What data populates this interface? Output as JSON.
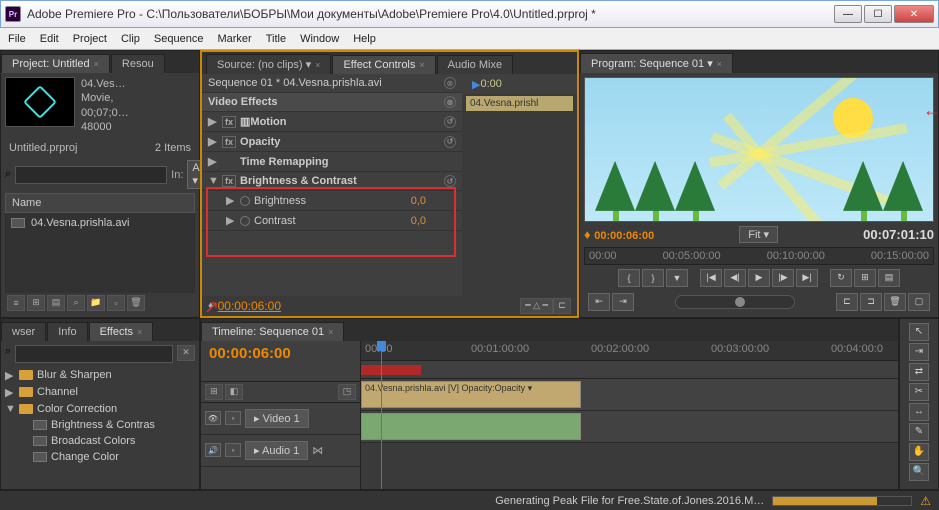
{
  "window": {
    "app_icon_text": "Pr",
    "title": "Adobe Premiere Pro - C:\\Пользователи\\БОБРЫ\\Мои документы\\Adobe\\Premiere Pro\\4.0\\Untitled.prproj *"
  },
  "menu": [
    "File",
    "Edit",
    "Project",
    "Clip",
    "Sequence",
    "Marker",
    "Title",
    "Window",
    "Help"
  ],
  "project": {
    "tab1": "Project: Untitled",
    "tab2": "Resou",
    "preview": {
      "name": "04.Ves…",
      "type": "Movie,",
      "dur": "00;07;0…",
      "rate": "48000 "
    },
    "name": "Untitled.prproj",
    "items_count": "2 Items",
    "search_placeholder": "",
    "search_icon": "⌕",
    "in_label": "In:",
    "in_value": "All",
    "header": "Name",
    "item1": "04.Vesna.prishla.avi"
  },
  "source_tabs": {
    "t1": "Source: (no clips)",
    "t2": "Effect Controls",
    "t3": "Audio Mixe"
  },
  "effect_controls": {
    "title": "Sequence 01 * 04.Vesna.prishla.avi",
    "section": "Video Effects",
    "r_motion": "Motion",
    "r_opacity": "Opacity",
    "r_time": "Time Remapping",
    "r_bc": "Brightness & Contrast",
    "r_bright": "Brightness",
    "r_bright_val": "0,0",
    "r_contrast": "Contrast",
    "r_contrast_val": "0,0",
    "tc": "00:00:06:00",
    "mini_tc": "0:00",
    "clip_label": "04.Vesna.prishl"
  },
  "program": {
    "tab": "Program: Sequence 01",
    "tc": "00:00:06:00",
    "fit": "Fit",
    "dur": "00:07:01:10",
    "ruler": [
      "00:00",
      "00:05:00:00",
      "00:10:00:00",
      "00:15:00:00"
    ]
  },
  "effects_browser": {
    "tab1": "wser",
    "tab2": "Info",
    "tab3": "Effects",
    "items": [
      {
        "name": "Blur & Sharpen",
        "type": "folder",
        "indent": 0,
        "tri": "▶"
      },
      {
        "name": "Channel",
        "type": "folder",
        "indent": 0,
        "tri": "▶"
      },
      {
        "name": "Color Correction",
        "type": "folder",
        "indent": 0,
        "tri": "▼"
      },
      {
        "name": "Brightness & Contras",
        "type": "fx",
        "indent": 1,
        "tri": ""
      },
      {
        "name": "Broadcast Colors",
        "type": "fx",
        "indent": 1,
        "tri": ""
      },
      {
        "name": "Change Color",
        "type": "fx",
        "indent": 1,
        "tri": ""
      }
    ]
  },
  "timeline": {
    "tab": "Timeline: Sequence 01",
    "tc": "00:00:06:00",
    "ruler": [
      "00:00",
      "00:01:00:00",
      "00:02:00:00",
      "00:03:00:00",
      "00:04:00:0"
    ],
    "video_track": "Video 1",
    "audio_track": "Audio 1",
    "clip_video": "04.Vesna.prishla.avi [V] Opacity:Opacity ▾",
    "clip_audio": ""
  },
  "status": {
    "text": "Generating Peak File for Free.State.of.Jones.2016.M…"
  }
}
